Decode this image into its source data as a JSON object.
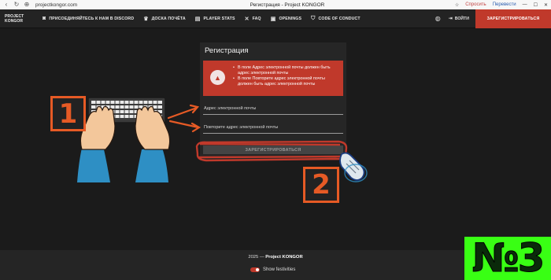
{
  "browser": {
    "url": "projectkongor.com",
    "window_title": "Регистрация - Project KONGOR",
    "actions": [
      "Спросить",
      "Перевести"
    ]
  },
  "navbar": {
    "brand": "PROJECT KONGOR",
    "items": [
      {
        "label": "ПРИСОЕДИНЯЙТЕСЬ К НАМ В DISCORD",
        "icon": "discord-icon"
      },
      {
        "label": "ДОСКА ПОЧЁТА",
        "icon": "trophy-icon"
      },
      {
        "label": "PLAYER STATS",
        "icon": "chart-icon"
      },
      {
        "label": "FAQ",
        "icon": "tools-icon"
      },
      {
        "label": "OPENINGS",
        "icon": "briefcase-icon"
      },
      {
        "label": "CODE OF CONDUCT",
        "icon": "shield-icon"
      }
    ],
    "login": "ВОЙТИ",
    "register": "ЗАРЕГИСТРИРОВАТЬСЯ"
  },
  "form": {
    "title": "Регистрация",
    "errors": [
      "В поле Адрес электронной почты должен быть адрес электронной почты",
      "В поле Повторите адрес электронной почты должен быть адрес электронной почты"
    ],
    "email_placeholder": "Адрес электронной почты",
    "email_repeat_placeholder": "Повторите адрес электронной почты",
    "submit": "ЗАРЕГИСТРИРОВАТЬСЯ"
  },
  "annotations": {
    "step1": "1",
    "step2": "2",
    "badge": "№3",
    "accent": "#e65a25",
    "badge_color": "#39ff14"
  },
  "footer": {
    "copyright_year": "2025 —",
    "copyright_name": "Project KONGOR",
    "festive_label": "Show festivities"
  },
  "colors": {
    "primary": "#c0392b",
    "background": "#1b1b1b",
    "panel": "#262626"
  }
}
